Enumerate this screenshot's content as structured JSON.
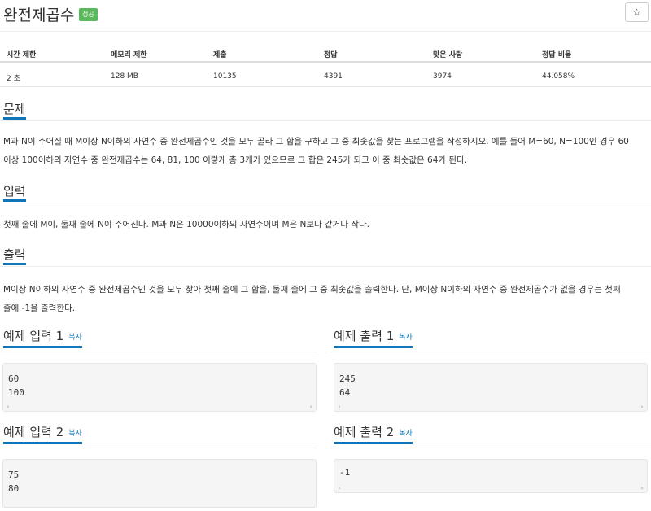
{
  "header": {
    "title": "완전제곱수",
    "badge": "성공",
    "star": "☆"
  },
  "stats": {
    "headers": [
      "시간 제한",
      "메모리 제한",
      "제출",
      "정답",
      "맞은 사람",
      "정답 비율"
    ],
    "values": [
      "2 초",
      "128 MB",
      "10135",
      "4391",
      "3974",
      "44.058%"
    ]
  },
  "sections": {
    "problem": {
      "title": "문제",
      "line1": "M과 N이 주어질 때 M이상 N이하의 자연수 중 완전제곱수인 것을 모두 골라 그 합을 구하고 그 중 최솟값을 찾는 프로그램을 작성하시오. 예를 들어 M=60, N=100인 경우 60",
      "line2": "이상 100이하의 자연수 중 완전제곱수는 64,  81,  100 이렇게 총 3개가 있으므로 그 합은 245가 되고 이 중 최솟값은 64가 된다."
    },
    "input": {
      "title": "입력",
      "text": "첫째 줄에 M이, 둘째 줄에 N이 주어진다. M과 N은 10000이하의 자연수이며 M은 N보다 같거나 작다."
    },
    "output": {
      "title": "출력",
      "line1": "M이상 N이하의 자연수 중 완전제곱수인 것을 모두 찾아 첫째 줄에 그 합을, 둘째 줄에 그 중 최솟값을 출력한다. 단, M이상 N이하의 자연수 중 완전제곱수가 없을 경우는 첫째",
      "line2": "줄에 -1을 출력한다."
    }
  },
  "examples": {
    "copy_label": "복사",
    "input1": {
      "title": "예제 입력 1",
      "code": "60\n100"
    },
    "output1": {
      "title": "예제 출력 1",
      "code": "245\n64"
    },
    "input2": {
      "title": "예제 입력 2",
      "code": "75\n80"
    },
    "output2": {
      "title": "예제 출력 2",
      "code": "-1"
    }
  },
  "scroll": {
    "left": "‹",
    "right": "›"
  },
  "colors": {
    "accent": "#0e76b8",
    "badge": "#5cb85c",
    "code_bg": "#f5f5f5"
  }
}
